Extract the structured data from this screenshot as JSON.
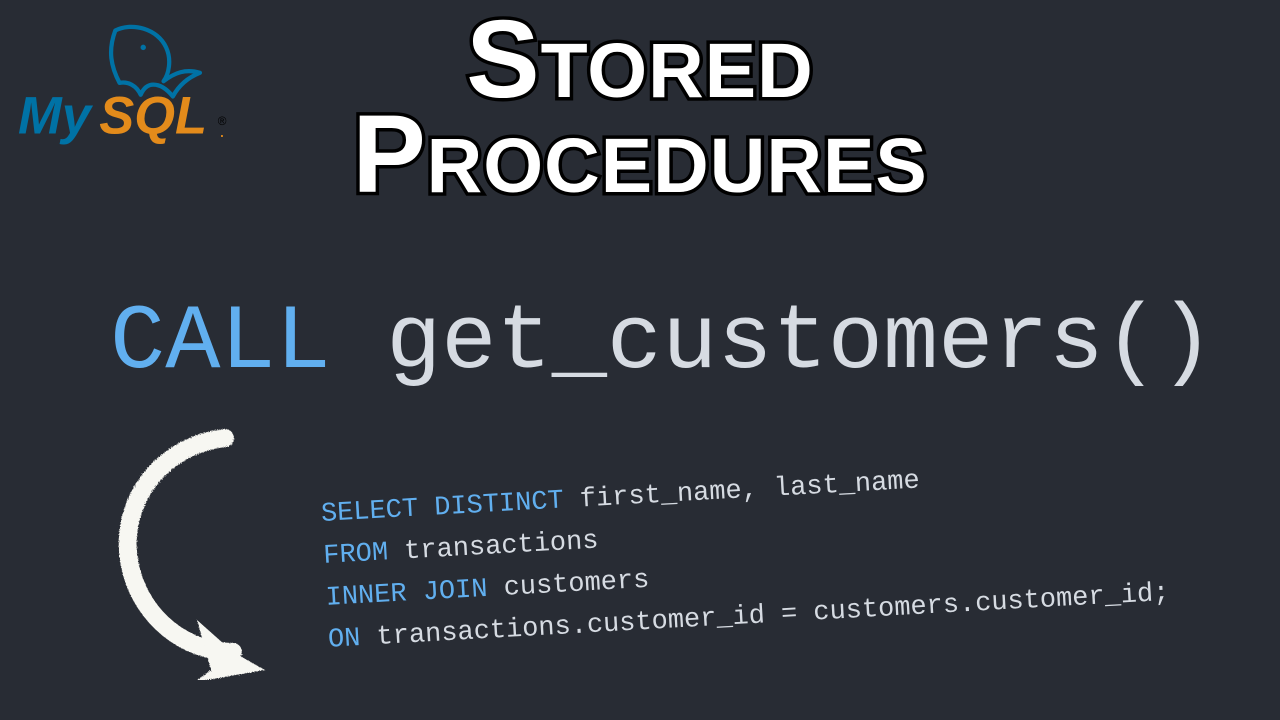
{
  "logo": {
    "name": "MySQL",
    "my_color": "#0072A5",
    "sql_color": "#E38B1B"
  },
  "title": {
    "line1": "Stored",
    "line2": "Procedures"
  },
  "call_statement": {
    "keyword": "CALL",
    "function": "get_customers",
    "parens": "()"
  },
  "sql": {
    "line1": {
      "kw": "SELECT DISTINCT",
      "rest": " first_name, last_name"
    },
    "line2": {
      "kw": "FROM",
      "rest": " transactions"
    },
    "line3": {
      "kw": "INNER JOIN",
      "rest": " customers"
    },
    "line4": {
      "kw": "ON",
      "rest": " transactions.customer_id = customers.customer_id;"
    }
  },
  "colors": {
    "bg": "#282c34",
    "keyword": "#61afef",
    "text": "#d6dbe2"
  }
}
